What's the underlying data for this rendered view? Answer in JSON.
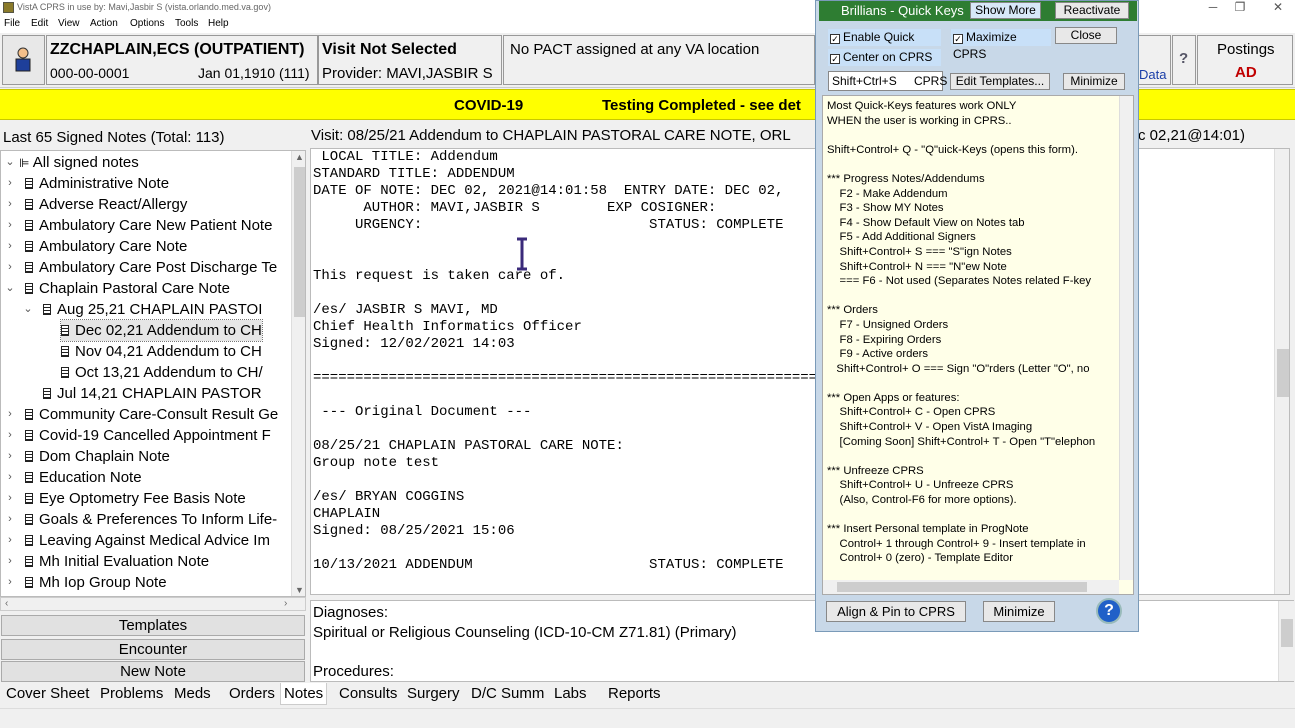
{
  "window": {
    "title": "VistA CPRS in use by: Mavi,Jasbir S  (vista.orlando.med.va.gov)",
    "min": "─",
    "max": "❐",
    "close": "✕"
  },
  "menu": [
    "File",
    "Edit",
    "View",
    "Action",
    "Options",
    "Tools",
    "Help"
  ],
  "patient": {
    "name": "ZZCHAPLAIN,ECS (OUTPATIENT)",
    "ssn": "000-00-0001",
    "dob": "Jan 01,1910 (111)"
  },
  "visit": {
    "status": "Visit Not Selected",
    "provider": "Provider:  MAVI,JASBIR S"
  },
  "pact": "No PACT assigned at any VA location",
  "rdata_fragment": "Data",
  "postings": {
    "label": "Postings",
    "value": "AD"
  },
  "covid_banner": {
    "left": "COVID-19",
    "right": "Testing Completed - see det"
  },
  "notes_header": {
    "left": "Last 65 Signed Notes (Total: 113)",
    "right": "Visit: 08/25/21     Addendum to CHAPLAIN PASTORAL CARE NOTE, ORL",
    "right_tail": "c 02,21@14:01)"
  },
  "tree": {
    "root": "All signed notes",
    "items": [
      {
        "label": "Administrative Note"
      },
      {
        "label": "Adverse React/Allergy"
      },
      {
        "label": "Ambulatory Care New Patient Note"
      },
      {
        "label": "Ambulatory Care Note"
      },
      {
        "label": "Ambulatory Care Post Discharge Te"
      },
      {
        "label": "Chaplain Pastoral Care Note"
      },
      {
        "label": "Aug 25,21  CHAPLAIN PASTOI"
      },
      {
        "label": "Dec 02,21  Addendum to CH"
      },
      {
        "label": "Nov 04,21  Addendum to CH"
      },
      {
        "label": "Oct 13,21  Addendum to CH/"
      },
      {
        "label": "Jul 14,21  CHAPLAIN PASTOR"
      },
      {
        "label": "Community Care-Consult Result Ge"
      },
      {
        "label": "Covid-19 Cancelled Appointment F"
      },
      {
        "label": "Dom Chaplain Note"
      },
      {
        "label": "Education Note"
      },
      {
        "label": "Eye Optometry Fee Basis Note"
      },
      {
        "label": "Goals & Preferences To Inform Life-"
      },
      {
        "label": "Leaving Against Medical Advice Im"
      },
      {
        "label": "Mh Initial Evaluation Note"
      },
      {
        "label": "Mh Iop Group Note"
      }
    ]
  },
  "side_buttons": {
    "templates": "Templates",
    "encounter": "Encounter",
    "new_note": "New Note"
  },
  "note_text": " LOCAL TITLE: Addendum\nSTANDARD TITLE: ADDENDUM\nDATE OF NOTE: DEC 02, 2021@14:01:58  ENTRY DATE: DEC 02,\n      AUTHOR: MAVI,JASBIR S        EXP COSIGNER:\n     URGENCY:                           STATUS: COMPLETE\n\n\nThis request is taken care of.\n\n/es/ JASBIR S MAVI, MD\nChief Health Informatics Officer\nSigned: 12/02/2021 14:03\n\n===================================================================\n\n --- Original Document ---\n\n08/25/21 CHAPLAIN PASTORAL CARE NOTE:\nGroup note test\n\n/es/ BRYAN COGGINS\nCHAPLAIN\nSigned: 08/25/2021 15:06\n\n10/13/2021 ADDENDUM                     STATUS: COMPLETE",
  "diagnoses": {
    "label": "Diagnoses:",
    "value": "Spiritual or Religious Counseling (ICD-10-CM Z71.81) (Primary)",
    "procedures": "Procedures:"
  },
  "tabs": [
    "Cover Sheet",
    "Problems",
    "Meds",
    "Orders",
    "Notes",
    "Consults",
    "Surgery",
    "D/C Summ",
    "Labs",
    "Reports"
  ],
  "quickkeys": {
    "title": "Brillians - Quick Keys",
    "show_more": "Show More",
    "reactivate": "Reactivate",
    "enable": "Enable Quick Keys",
    "maximize": "Maximize CPRS",
    "close": "Close",
    "center": "Center on CPRS",
    "hotkey": "Shift+Ctrl+S",
    "hotkey_target": "CPRS",
    "edit_templates": "Edit Templates...",
    "minimize": "Minimize",
    "align": "Align & Pin to CPRS",
    "minimize2": "Minimize",
    "help": "?",
    "info": "Most Quick-Keys features work ONLY\nWHEN the user is working in CPRS..\n\nShift+Control+ Q - \"Q\"uick-Keys (opens this form).\n\n*** Progress Notes/Addendums\n    F2 - Make Addendum\n    F3 - Show MY Notes\n    F4 - Show Default View on Notes tab\n    F5 - Add Additional Signers\n    Shift+Control+ S === \"S\"ign Notes\n    Shift+Control+ N === \"N\"ew Note\n    === F6 - Not used (Separates Notes related F-key\n\n*** Orders\n    F7 - Unsigned Orders\n    F8 - Expiring Orders\n    F9 - Active orders\n   Shift+Control+ O === Sign \"O\"rders (Letter \"O\", no\n\n*** Open Apps or features:\n    Shift+Control+ C - Open CPRS\n    Shift+Control+ V - Open VistA Imaging\n    [Coming Soon] Shift+Control+ T - Open \"T\"elephon\n\n*** Unfreeze CPRS\n    Shift+Control+ U - Unfreeze CPRS\n    (Also, Control-F6 for more options).\n\n*** Insert Personal template in ProgNote\n    Control+ 1 through Control+ 9 - Insert template in\n    Control+ 0 (zero) - Template Editor"
  }
}
